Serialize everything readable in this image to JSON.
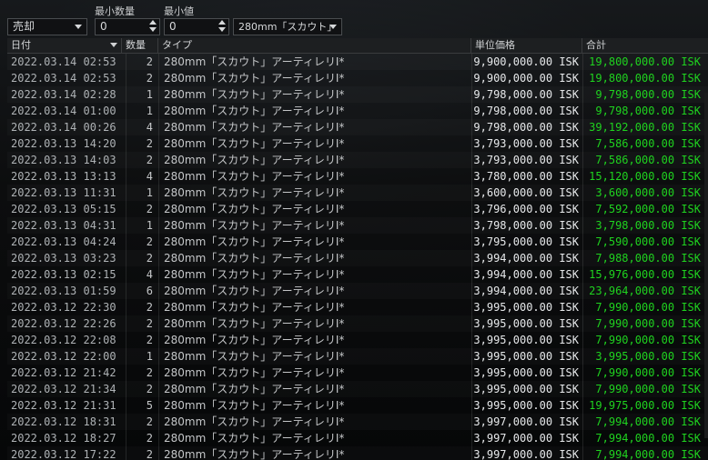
{
  "filters": {
    "order_type": "売却",
    "min_qty_label": "最小数量",
    "min_qty_value": "0",
    "min_value_label": "最小値",
    "min_value_value": "0",
    "item_filter": "280mm「スカウト」"
  },
  "columns": {
    "date": "日付",
    "qty": "数量",
    "type": "タイプ",
    "unit_price": "単位価格",
    "total": "合計"
  },
  "rows": [
    {
      "date": "2022.03.14 02:53",
      "qty": "2",
      "type": "280mm「スカウト」アーティレリI*",
      "price": "9,900,000.00 ISK",
      "total": "19,800,000.00 ISK"
    },
    {
      "date": "2022.03.14 02:53",
      "qty": "2",
      "type": "280mm「スカウト」アーティレリI*",
      "price": "9,900,000.00 ISK",
      "total": "19,800,000.00 ISK"
    },
    {
      "date": "2022.03.14 02:28",
      "qty": "1",
      "type": "280mm「スカウト」アーティレリI*",
      "price": "9,798,000.00 ISK",
      "total": "9,798,000.00 ISK"
    },
    {
      "date": "2022.03.14 01:00",
      "qty": "1",
      "type": "280mm「スカウト」アーティレリI*",
      "price": "9,798,000.00 ISK",
      "total": "9,798,000.00 ISK"
    },
    {
      "date": "2022.03.14 00:26",
      "qty": "4",
      "type": "280mm「スカウト」アーティレリI*",
      "price": "9,798,000.00 ISK",
      "total": "39,192,000.00 ISK"
    },
    {
      "date": "2022.03.13 14:20",
      "qty": "2",
      "type": "280mm「スカウト」アーティレリI*",
      "price": "3,793,000.00 ISK",
      "total": "7,586,000.00 ISK"
    },
    {
      "date": "2022.03.13 14:03",
      "qty": "2",
      "type": "280mm「スカウト」アーティレリI*",
      "price": "3,793,000.00 ISK",
      "total": "7,586,000.00 ISK"
    },
    {
      "date": "2022.03.13 13:13",
      "qty": "4",
      "type": "280mm「スカウト」アーティレリI*",
      "price": "3,780,000.00 ISK",
      "total": "15,120,000.00 ISK"
    },
    {
      "date": "2022.03.13 11:31",
      "qty": "1",
      "type": "280mm「スカウト」アーティレリI*",
      "price": "3,600,000.00 ISK",
      "total": "3,600,000.00 ISK"
    },
    {
      "date": "2022.03.13 05:15",
      "qty": "2",
      "type": "280mm「スカウト」アーティレリI*",
      "price": "3,796,000.00 ISK",
      "total": "7,592,000.00 ISK"
    },
    {
      "date": "2022.03.13 04:31",
      "qty": "1",
      "type": "280mm「スカウト」アーティレリI*",
      "price": "3,798,000.00 ISK",
      "total": "3,798,000.00 ISK"
    },
    {
      "date": "2022.03.13 04:24",
      "qty": "2",
      "type": "280mm「スカウト」アーティレリI*",
      "price": "3,795,000.00 ISK",
      "total": "7,590,000.00 ISK"
    },
    {
      "date": "2022.03.13 03:23",
      "qty": "2",
      "type": "280mm「スカウト」アーティレリI*",
      "price": "3,994,000.00 ISK",
      "total": "7,988,000.00 ISK"
    },
    {
      "date": "2022.03.13 02:15",
      "qty": "4",
      "type": "280mm「スカウト」アーティレリI*",
      "price": "3,994,000.00 ISK",
      "total": "15,976,000.00 ISK"
    },
    {
      "date": "2022.03.13 01:59",
      "qty": "6",
      "type": "280mm「スカウト」アーティレリI*",
      "price": "3,994,000.00 ISK",
      "total": "23,964,000.00 ISK"
    },
    {
      "date": "2022.03.12 22:30",
      "qty": "2",
      "type": "280mm「スカウト」アーティレリI*",
      "price": "3,995,000.00 ISK",
      "total": "7,990,000.00 ISK"
    },
    {
      "date": "2022.03.12 22:26",
      "qty": "2",
      "type": "280mm「スカウト」アーティレリI*",
      "price": "3,995,000.00 ISK",
      "total": "7,990,000.00 ISK"
    },
    {
      "date": "2022.03.12 22:08",
      "qty": "2",
      "type": "280mm「スカウト」アーティレリI*",
      "price": "3,995,000.00 ISK",
      "total": "7,990,000.00 ISK"
    },
    {
      "date": "2022.03.12 22:00",
      "qty": "1",
      "type": "280mm「スカウト」アーティレリI*",
      "price": "3,995,000.00 ISK",
      "total": "3,995,000.00 ISK"
    },
    {
      "date": "2022.03.12 21:42",
      "qty": "2",
      "type": "280mm「スカウト」アーティレリI*",
      "price": "3,995,000.00 ISK",
      "total": "7,990,000.00 ISK"
    },
    {
      "date": "2022.03.12 21:34",
      "qty": "2",
      "type": "280mm「スカウト」アーティレリI*",
      "price": "3,995,000.00 ISK",
      "total": "7,990,000.00 ISK"
    },
    {
      "date": "2022.03.12 21:31",
      "qty": "5",
      "type": "280mm「スカウト」アーティレリI*",
      "price": "3,995,000.00 ISK",
      "total": "19,975,000.00 ISK"
    },
    {
      "date": "2022.03.12 18:31",
      "qty": "2",
      "type": "280mm「スカウト」アーティレリI*",
      "price": "3,997,000.00 ISK",
      "total": "7,994,000.00 ISK"
    },
    {
      "date": "2022.03.12 18:27",
      "qty": "2",
      "type": "280mm「スカウト」アーティレリI*",
      "price": "3,997,000.00 ISK",
      "total": "7,994,000.00 ISK"
    },
    {
      "date": "2022.03.12 17:22",
      "qty": "2",
      "type": "280mm「スカウト」アーティレリI*",
      "price": "3,997,000.00 ISK",
      "total": "7,994,000.00 ISK"
    }
  ],
  "colors": {
    "total_text": "#1fd31f",
    "background": "#0b0c0d"
  }
}
